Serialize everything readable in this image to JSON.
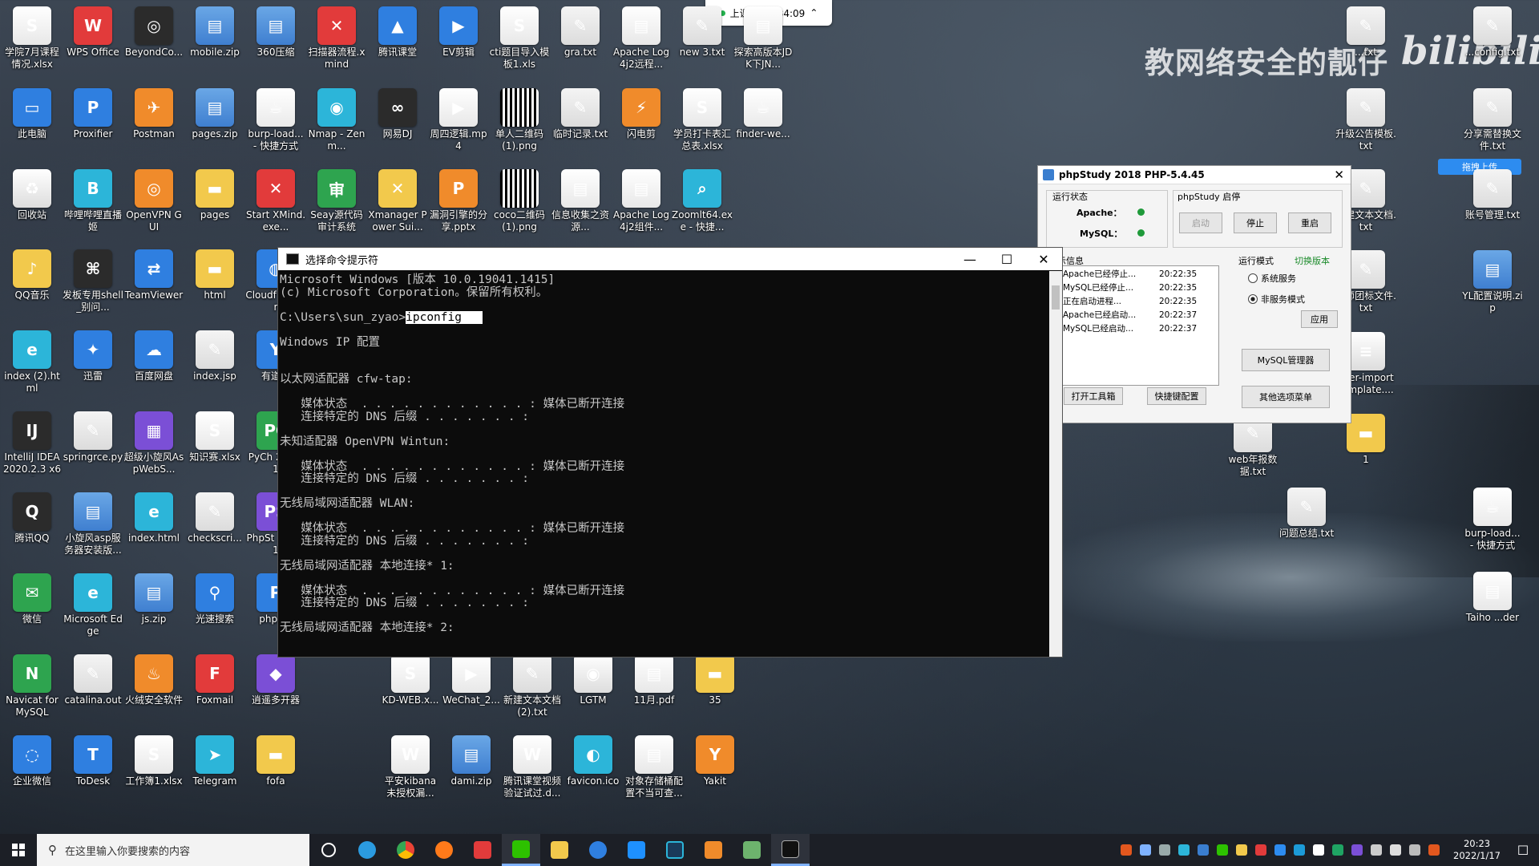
{
  "watermark": {
    "text": "教网络安全的靓仔",
    "brand": "bilibili"
  },
  "meeting_badge": {
    "text": "上课中 00:34:09",
    "chevron": "^"
  },
  "upload_tag": "拖拽上传",
  "desktop_icons": [
    {
      "label": "学院7月课程情况.xlsx",
      "icon": "xlsx-icon"
    },
    {
      "label": "WPS Office",
      "icon": "wps-icon"
    },
    {
      "label": "BeyondCo...",
      "icon": "beyond-compare-icon"
    },
    {
      "label": "mobile.zip",
      "icon": "zip-icon"
    },
    {
      "label": "360压缩",
      "icon": "zip-icon"
    },
    {
      "label": "扫描器流程.xmind",
      "icon": "xmind-icon"
    },
    {
      "label": "腾讯课堂",
      "icon": "tencent-class-icon"
    },
    {
      "label": "EV剪辑",
      "icon": "ev-icon"
    },
    {
      "label": "cti题目导入模板1.xls",
      "icon": "xlsx-icon"
    },
    {
      "label": "gra.txt",
      "icon": "txt-icon"
    },
    {
      "label": "Apache Log4j2远程...",
      "icon": "pdf-icon"
    },
    {
      "label": "new 3.txt",
      "icon": "txt-icon"
    },
    {
      "label": "探索高版本JDK下JN...",
      "icon": "pdf-icon"
    },
    {
      "label": "此电脑",
      "icon": "pc-icon"
    },
    {
      "label": "Proxifier",
      "icon": "proxifier-icon"
    },
    {
      "label": "Postman",
      "icon": "postman-icon"
    },
    {
      "label": "pages.zip",
      "icon": "zip-icon"
    },
    {
      "label": "burp-load... - 快捷方式",
      "icon": "java-icon"
    },
    {
      "label": "Nmap - Zenm...",
      "icon": "nmap-icon"
    },
    {
      "label": "网易DJ",
      "icon": "dj-icon"
    },
    {
      "label": "周四逻辑.mp4",
      "icon": "mp4-icon"
    },
    {
      "label": "单人二维码(1).png",
      "icon": "qr-icon"
    },
    {
      "label": "临时记录.txt",
      "icon": "txt-icon"
    },
    {
      "label": "闪电剪",
      "icon": "lightning-icon"
    },
    {
      "label": "学员打卡表汇总表.xlsx",
      "icon": "xlsx-icon"
    },
    {
      "label": "finder-we...",
      "icon": "java-icon"
    },
    {
      "label": "回收站",
      "icon": "recycle-bin-icon"
    },
    {
      "label": "哔哩哔哩直播姬",
      "icon": "bilibili-icon"
    },
    {
      "label": "OpenVPN GUI",
      "icon": "openvpn-icon"
    },
    {
      "label": "pages",
      "icon": "folder-icon"
    },
    {
      "label": "Start XMind.exe...",
      "icon": "xmind-icon"
    },
    {
      "label": "Seay源代码审计系统",
      "icon": "seay-icon"
    },
    {
      "label": "Xmanager Power Sui...",
      "icon": "xmanager-icon"
    },
    {
      "label": "漏洞引擎的分享.pptx",
      "icon": "pptx-icon"
    },
    {
      "label": "coco二维码(1).png",
      "icon": "qr-icon"
    },
    {
      "label": "信息收集之资源...",
      "icon": "pdf-icon"
    },
    {
      "label": "Apache Log4j2组件...",
      "icon": "pdf-icon"
    },
    {
      "label": "Zoomlt64.exe - 快捷...",
      "icon": "zoomit-icon"
    },
    {
      "label": "QQ音乐",
      "icon": "qqmusic-icon"
    },
    {
      "label": "发板专用shell_别问...",
      "icon": "shell-icon"
    },
    {
      "label": "TeamViewer",
      "icon": "teamviewer-icon"
    },
    {
      "label": "html",
      "icon": "folder-icon"
    },
    {
      "label": "Cloudf Explor",
      "icon": "chrome-icon"
    },
    {
      "label": "index (2).html",
      "icon": "edge-icon"
    },
    {
      "label": "迅雷",
      "icon": "xunlei-icon"
    },
    {
      "label": "百度网盘",
      "icon": "baidu-icon"
    },
    {
      "label": "index.jsp",
      "icon": "txt-icon"
    },
    {
      "label": "有道云",
      "icon": "youdao-icon"
    },
    {
      "label": "IntelliJ IDEA 2020.2.3 x64",
      "icon": "idea-icon"
    },
    {
      "label": "springrce.py",
      "icon": "txt-icon"
    },
    {
      "label": "超级小旋风AspWebS...",
      "icon": "server-icon"
    },
    {
      "label": "知识赛.xlsx",
      "icon": "xlsx-icon"
    },
    {
      "label": "PyCh 2021.1",
      "icon": "pycharm-icon"
    },
    {
      "label": "腾讯QQ",
      "icon": "qq-icon"
    },
    {
      "label": "小旋风asp服务器安装版...",
      "icon": "zip-icon"
    },
    {
      "label": "index.html",
      "icon": "edge-icon"
    },
    {
      "label": "checkscri...",
      "icon": "txt-icon"
    },
    {
      "label": "PhpSt 2021.1",
      "icon": "phpstorm-icon"
    },
    {
      "label": "微信",
      "icon": "wechat-icon"
    },
    {
      "label": "Microsoft Edge",
      "icon": "edge-icon"
    },
    {
      "label": "js.zip",
      "icon": "zip-icon"
    },
    {
      "label": "光速搜索",
      "icon": "search-app-icon"
    },
    {
      "label": "phpstu",
      "icon": "phpstudy-icon"
    },
    {
      "label": "Navicat for MySQL",
      "icon": "navicat-icon"
    },
    {
      "label": "catalina.out",
      "icon": "txt-icon"
    },
    {
      "label": "火绒安全软件",
      "icon": "huorong-icon"
    },
    {
      "label": "Foxmail",
      "icon": "foxmail-icon"
    },
    {
      "label": "逍遥多开器",
      "icon": "xiaoyao-icon"
    },
    {
      "label": "KD-WEB.x...",
      "icon": "xlsx-icon"
    },
    {
      "label": "WeChat_2...",
      "icon": "mp4-icon"
    },
    {
      "label": "新建文本文档(2).txt",
      "icon": "txt-icon"
    },
    {
      "label": "LGTM",
      "icon": "lgtm-icon"
    },
    {
      "label": "11月.pdf",
      "icon": "pdf-icon"
    },
    {
      "label": "35",
      "icon": "folder-icon"
    },
    {
      "label": "企业微信",
      "icon": "wecom-icon"
    },
    {
      "label": "ToDesk",
      "icon": "todesk-icon"
    },
    {
      "label": "工作簿1.xlsx",
      "icon": "xlsx-icon"
    },
    {
      "label": "Telegram",
      "icon": "telegram-icon"
    },
    {
      "label": "fofa",
      "icon": "folder-icon"
    },
    {
      "label": "平安kibana未授权漏...",
      "icon": "docx-icon"
    },
    {
      "label": "dami.zip",
      "icon": "zip-icon"
    },
    {
      "label": "腾讯课堂视频验证试过.d...",
      "icon": "docx-icon"
    },
    {
      "label": "favicon.ico",
      "icon": "ico-icon"
    },
    {
      "label": "对象存储桶配置不当可查...",
      "icon": "pdf-icon"
    },
    {
      "label": "Yakit",
      "icon": "yakit-icon"
    },
    {
      "label": "...txt",
      "icon": "txt-icon"
    },
    {
      "label": "...config.txt",
      "icon": "txt-icon"
    },
    {
      "label": "升级公告模板.txt",
      "icon": "txt-icon"
    },
    {
      "label": "分享需替换文件.txt",
      "icon": "txt-icon"
    },
    {
      "label": "新建文本文档.txt",
      "icon": "txt-icon"
    },
    {
      "label": "账号管理.txt",
      "icon": "txt-icon"
    },
    {
      "label": "金师团标文件.txt",
      "icon": "txt-icon"
    },
    {
      "label": "YL配置说明.zip",
      "icon": "zip-icon"
    },
    {
      "label": "user-import template....",
      "icon": "doc-icon"
    },
    {
      "label": "1",
      "icon": "folder-icon"
    },
    {
      "label": "web年报数据.txt",
      "icon": "txt-icon"
    },
    {
      "label": "问题总结.txt",
      "icon": "txt-icon"
    },
    {
      "label": "burp-load... - 快捷方式",
      "icon": "java-icon"
    },
    {
      "label": "Taiho ...der",
      "icon": "pdf-icon"
    }
  ],
  "cmd": {
    "title": "选择命令提示符",
    "controls": {
      "min": "—",
      "max": "☐",
      "close": "✕"
    },
    "lines": [
      "Microsoft Windows [版本 10.0.19041.1415]",
      "(c) Microsoft Corporation。保留所有权利。",
      "",
      "C:\\Users\\sun_zyao>",
      "",
      "Windows IP 配置",
      "",
      "",
      "以太网适配器 cfw-tap:",
      "",
      "   媒体状态  . . . . . . . . . . . . : 媒体已断开连接",
      "   连接特定的 DNS 后缀 . . . . . . . :",
      "",
      "未知适配器 OpenVPN Wintun:",
      "",
      "   媒体状态  . . . . . . . . . . . . : 媒体已断开连接",
      "   连接特定的 DNS 后缀 . . . . . . . :",
      "",
      "无线局域网适配器 WLAN:",
      "",
      "   媒体状态  . . . . . . . . . . . . : 媒体已断开连接",
      "   连接特定的 DNS 后缀 . . . . . . . :",
      "",
      "无线局域网适配器 本地连接* 1:",
      "",
      "   媒体状态  . . . . . . . . . . . . : 媒体已断开连接",
      "   连接特定的 DNS 后缀 . . . . . . . :",
      "",
      "无线局域网适配器 本地连接* 2:"
    ],
    "selected_command": "ipconfig"
  },
  "phpstudy": {
    "title": "phpStudy 2018   PHP-5.4.45",
    "status_label": "运行状态",
    "apache_label": "Apache：",
    "mysql_label": "MySQL：",
    "service_label": "phpStudy 启停",
    "btn_start": "启动",
    "btn_stop": "停止",
    "btn_restart": "重启",
    "info_label": "示信息",
    "mode_label": "运行模式",
    "switch_label": "切换版本",
    "radio_system": "系统服务",
    "radio_nonservice": "非服务模式",
    "btn_apply": "应用",
    "btn_mysql": "MySQL管理器",
    "btn_toolbox": "打开工具箱",
    "btn_quickconfig": "快捷键配置",
    "btn_other": "其他选项菜单",
    "log": [
      {
        "msg": "Apache已经停止...",
        "time": "20:22:35"
      },
      {
        "msg": "MySQL已经停止...",
        "time": "20:22:35"
      },
      {
        "msg": "正在启动进程...",
        "time": "20:22:35"
      },
      {
        "msg": "Apache已经启动...",
        "time": "20:22:37"
      },
      {
        "msg": "MySQL已经启动...",
        "time": "20:22:37"
      }
    ],
    "status_color": "#1f9a3a"
  },
  "taskbar": {
    "search_placeholder": "在这里输入你要搜索的内容",
    "time": "20:23",
    "date": "2022/1/17",
    "notification_icon": "notification-icon"
  }
}
